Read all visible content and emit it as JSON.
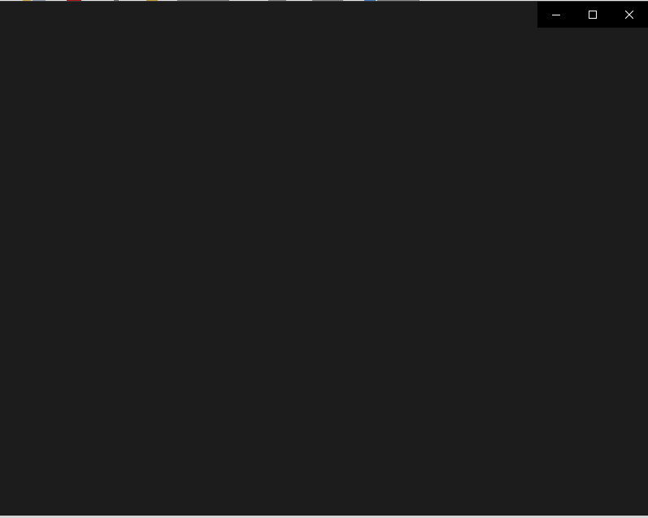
{
  "window": {
    "background": "#1c1c1c",
    "caption_background": "#000000",
    "controls": [
      {
        "name": "minimize-button",
        "icon": "minimize-icon"
      },
      {
        "name": "maximize-button",
        "icon": "maximize-icon"
      },
      {
        "name": "close-button",
        "icon": "close-icon"
      }
    ]
  },
  "colors": {
    "caption_glyph": "#ffffff",
    "close_hover": "#e81123"
  }
}
